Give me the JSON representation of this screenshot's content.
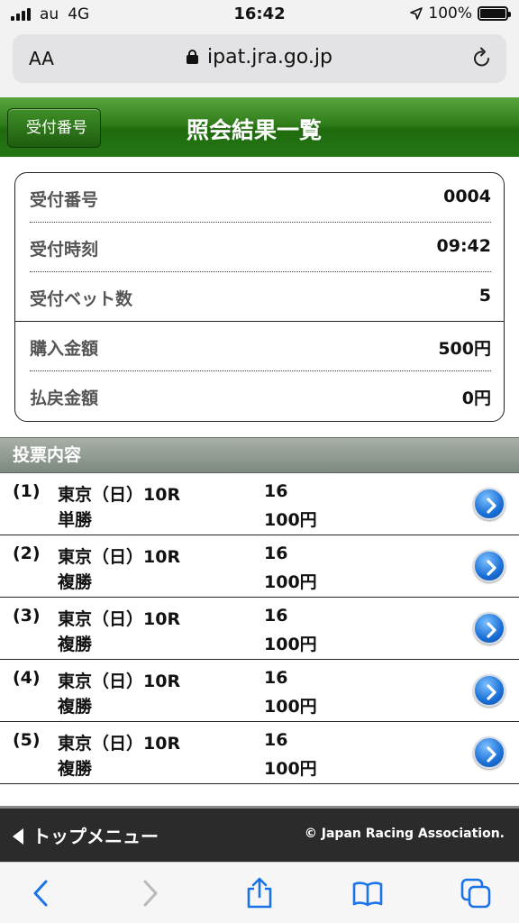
{
  "status": {
    "carrier": "au",
    "network": "4G",
    "time": "16:42",
    "battery": "100%"
  },
  "browser": {
    "text_size": "AA",
    "url": "ipat.jra.go.jp"
  },
  "header": {
    "back_label": "受付番号",
    "title": "照会結果一覧"
  },
  "summary": {
    "rows": [
      {
        "label": "受付番号",
        "value": "0004"
      },
      {
        "label": "受付時刻",
        "value": "09:42"
      },
      {
        "label": "受付ベット数",
        "value": "5"
      },
      {
        "label": "購入金額",
        "value": "500円"
      },
      {
        "label": "払戻金額",
        "value": "0円"
      }
    ]
  },
  "section": {
    "title": "投票内容"
  },
  "bets": [
    {
      "num": "(1)",
      "race": "東京（日）10R",
      "type": "単勝",
      "horse": "16",
      "amount": "100円"
    },
    {
      "num": "(2)",
      "race": "東京（日）10R",
      "type": "複勝",
      "horse": "16",
      "amount": "100円"
    },
    {
      "num": "(3)",
      "race": "東京（日）10R",
      "type": "複勝",
      "horse": "16",
      "amount": "100円"
    },
    {
      "num": "(4)",
      "race": "東京（日）10R",
      "type": "複勝",
      "horse": "16",
      "amount": "100円"
    },
    {
      "num": "(5)",
      "race": "東京（日）10R",
      "type": "複勝",
      "horse": "16",
      "amount": "100円"
    }
  ],
  "footer": {
    "top_menu": "トップメニュー",
    "copyright": "© Japan Racing Association."
  },
  "colors": {
    "header_green": "#2f7d1b",
    "section_gray": "#8f9a90",
    "footer_dark": "#2b2b2b",
    "ios_blue": "#1a73e8"
  }
}
